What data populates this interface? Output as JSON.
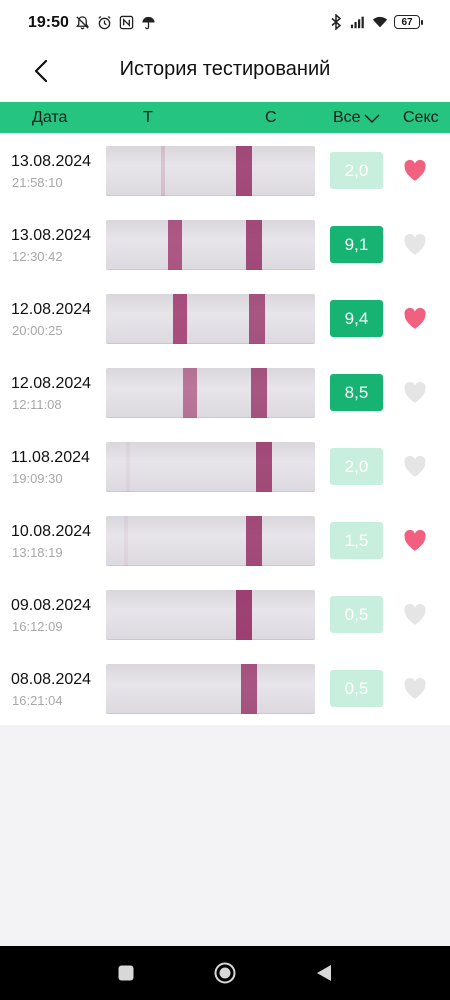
{
  "status_bar": {
    "time": "19:50",
    "battery": "67",
    "left_icons": [
      "alarm-off-icon",
      "alarm-clock-icon",
      "nfc-icon",
      "umbrella-icon"
    ],
    "right_icons": [
      "bluetooth-icon",
      "signal-icon",
      "wifi-icon",
      "battery-icon"
    ]
  },
  "header": {
    "title": "История тестирований",
    "back_icon": "back-arrow-icon"
  },
  "table_header": {
    "date": "Дата",
    "t": "T",
    "c": "C",
    "all": "Все",
    "sex": "Секс"
  },
  "colors": {
    "accent": "#25c480",
    "score_high": "#17b372",
    "score_low": "#c8efdd",
    "heart_active": "#f2607f",
    "heart_inactive": "#e5e5e5"
  },
  "rows": [
    {
      "date": "13.08.2024",
      "time": "21:58:10",
      "score": "2,0",
      "level": "low",
      "sex": true,
      "t_intensity": 0.15,
      "c_intensity": 0.75
    },
    {
      "date": "13.08.2024",
      "time": "12:30:42",
      "score": "9,1",
      "level": "high",
      "sex": false,
      "t_intensity": 0.7,
      "c_intensity": 0.75
    },
    {
      "date": "12.08.2024",
      "time": "20:00:25",
      "score": "9,4",
      "level": "high",
      "sex": true,
      "t_intensity": 0.75,
      "c_intensity": 0.7
    },
    {
      "date": "12.08.2024",
      "time": "12:11:08",
      "score": "8,5",
      "level": "high",
      "sex": false,
      "t_intensity": 0.55,
      "c_intensity": 0.7
    },
    {
      "date": "11.08.2024",
      "time": "19:09:30",
      "score": "2,0",
      "level": "low",
      "sex": false,
      "t_intensity": 0.05,
      "c_intensity": 0.75
    },
    {
      "date": "10.08.2024",
      "time": "13:18:19",
      "score": "1,5",
      "level": "low",
      "sex": true,
      "t_intensity": 0.05,
      "c_intensity": 0.75
    },
    {
      "date": "09.08.2024",
      "time": "16:12:09",
      "score": "0,5",
      "level": "low",
      "sex": false,
      "t_intensity": 0.0,
      "c_intensity": 0.8
    },
    {
      "date": "08.08.2024",
      "time": "16:21:04",
      "score": "0,5",
      "level": "low",
      "sex": false,
      "t_intensity": 0.0,
      "c_intensity": 0.7
    }
  ],
  "nav_bar": {
    "buttons": [
      "recent-apps-icon",
      "home-icon",
      "back-triangle-icon"
    ]
  }
}
